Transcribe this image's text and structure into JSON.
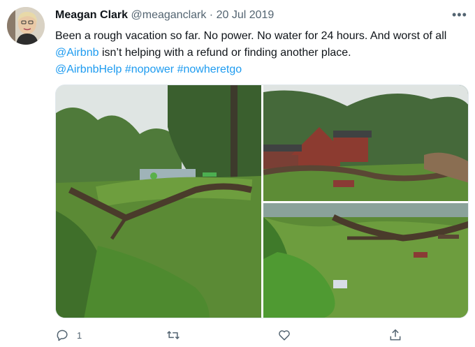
{
  "tweet": {
    "author_name": "Meagan Clark",
    "handle": "@meaganclark",
    "separator": "·",
    "date": "20 Jul 2019",
    "text_part1": "Been a rough vacation so far. No power. No water for 24 hours. And worst of all ",
    "mention_airbnb": "@Airbnb",
    "text_part2": " isn’t helping with a refund or finding another place.",
    "mention_help": "@AirbnbHelp",
    "hashtag_1": "#nopower",
    "hashtag_2": "#nowheretgo",
    "more_label": "•••"
  },
  "actions": {
    "reply_count": "1",
    "retweet_count": "",
    "like_count": ""
  },
  "colors": {
    "link": "#1d9bf0",
    "muted": "#536471",
    "text": "#0f1419"
  },
  "icons": {
    "reply": "reply-icon",
    "retweet": "retweet-icon",
    "like": "heart-icon",
    "share": "share-icon",
    "more": "more-icon"
  }
}
